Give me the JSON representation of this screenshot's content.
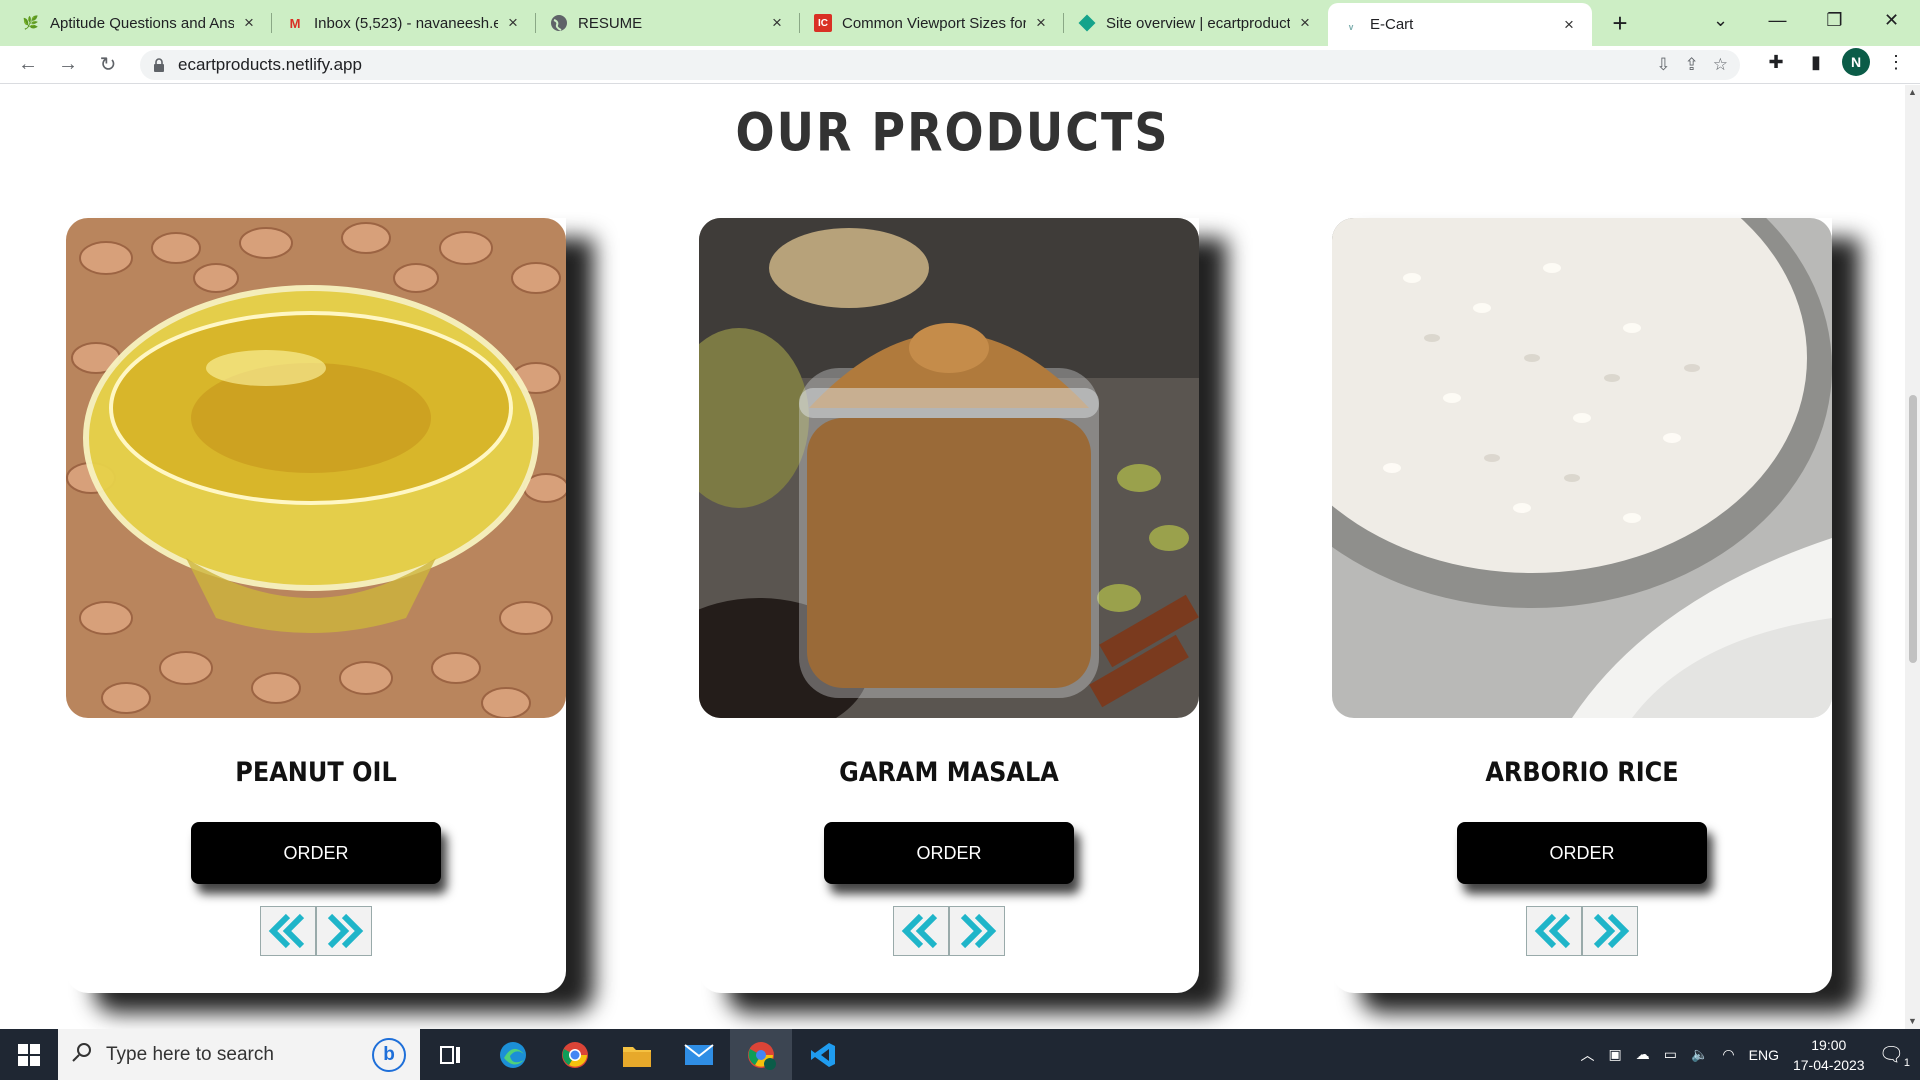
{
  "browser": {
    "tabs": [
      {
        "title": "Aptitude Questions and Answers",
        "icon": "leaf-icon"
      },
      {
        "title": "Inbox (5,523) - navaneesh.e",
        "icon": "gmail-icon"
      },
      {
        "title": "RESUME",
        "icon": "globe-icon"
      },
      {
        "title": "Common Viewport Sizes for",
        "icon": "ic-icon"
      },
      {
        "title": "Site overview | ecartproducts",
        "icon": "netlify-icon"
      },
      {
        "title": "E-Cart",
        "icon": "ecart-icon",
        "active": true
      }
    ],
    "url": "ecartproducts.netlify.app",
    "profile_initial": "N",
    "close_glyph": "×",
    "newtab_glyph": "+"
  },
  "page": {
    "heading": "OUR PRODUCTS",
    "products": [
      {
        "name": "PEANUT OIL",
        "order_label": "ORDER",
        "image": "peanut-oil-bowl"
      },
      {
        "name": "GARAM MASALA",
        "order_label": "ORDER",
        "image": "garam-masala-jar"
      },
      {
        "name": "ARBORIO RICE",
        "order_label": "ORDER",
        "image": "arborio-rice-bowl"
      }
    ],
    "accent_color": "#1fb5c9"
  },
  "taskbar": {
    "search_placeholder": "Type here to search",
    "language": "ENG",
    "time": "19:00",
    "date": "17-04-2023",
    "notification_count": "1"
  }
}
